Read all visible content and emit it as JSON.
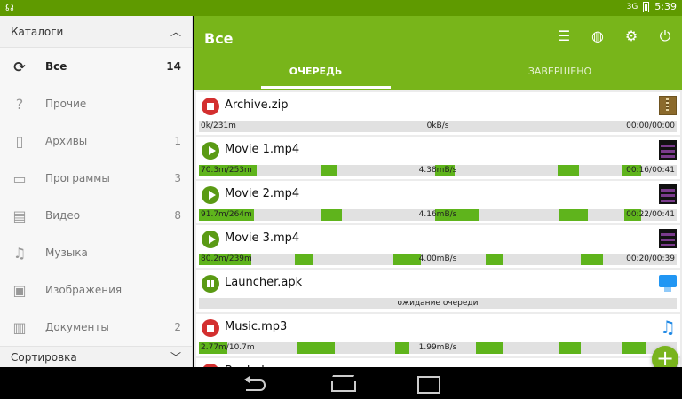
{
  "status_bar": {
    "left_icon": "☊",
    "signal": "3G",
    "time": "5:39"
  },
  "drawer": {
    "header": "Каталоги",
    "items": [
      {
        "icon": "refresh-icon",
        "glyph": "⟳",
        "label": "Все",
        "count": "14",
        "active": true
      },
      {
        "icon": "help-icon",
        "glyph": "?",
        "label": "Прочие",
        "count": ""
      },
      {
        "icon": "archive-icon",
        "glyph": "▯",
        "label": "Архивы",
        "count": "1"
      },
      {
        "icon": "monitor-icon",
        "glyph": "▭",
        "label": "Программы",
        "count": "3"
      },
      {
        "icon": "film-icon",
        "glyph": "▤",
        "label": "Видео",
        "count": "8"
      },
      {
        "icon": "music-icon",
        "glyph": "♫",
        "label": "Музыка",
        "count": ""
      },
      {
        "icon": "image-icon",
        "glyph": "▣",
        "label": "Изображения",
        "count": ""
      },
      {
        "icon": "document-icon",
        "glyph": "▥",
        "label": "Документы",
        "count": "2"
      }
    ],
    "sort_label": "Сортировка"
  },
  "appbar": {
    "title": "Все",
    "actions": [
      "list-icon",
      "globe-icon",
      "settings-icon",
      "power-icon"
    ],
    "tabs": [
      {
        "label": "ОЧЕРЕДЬ",
        "active": true
      },
      {
        "label": "ЗАВЕРШЕНО",
        "active": false
      }
    ]
  },
  "downloads": [
    {
      "name": "Archive.zip",
      "state": "stop",
      "type": "zip",
      "size": "0k/231m",
      "speed": "0kB/s",
      "time": "00:00/00:00",
      "segments": []
    },
    {
      "name": "Movie 1.mp4",
      "state": "play",
      "type": "video",
      "size": "70.3m/253m",
      "speed": "4.38mB/s",
      "time": "00:16/00:41",
      "segments": [
        [
          0.0,
          0.12
        ],
        [
          0.255,
          0.29
        ],
        [
          0.495,
          0.535
        ],
        [
          0.75,
          0.795
        ],
        [
          0.885,
          0.925
        ]
      ]
    },
    {
      "name": "Movie 2.mp4",
      "state": "play",
      "type": "video",
      "size": "91.7m/264m",
      "speed": "4.16mB/s",
      "time": "00:22/00:41",
      "segments": [
        [
          0.0,
          0.115
        ],
        [
          0.255,
          0.3
        ],
        [
          0.495,
          0.585
        ],
        [
          0.755,
          0.815
        ],
        [
          0.89,
          0.925
        ]
      ]
    },
    {
      "name": "Movie 3.mp4",
      "state": "play",
      "type": "video",
      "size": "80.2m/239m",
      "speed": "4.00mB/s",
      "time": "00:20/00:39",
      "segments": [
        [
          0.0,
          0.11
        ],
        [
          0.2,
          0.24
        ],
        [
          0.405,
          0.465
        ],
        [
          0.6,
          0.635
        ],
        [
          0.8,
          0.845
        ]
      ]
    },
    {
      "name": "Launcher.apk",
      "state": "pause",
      "type": "apk",
      "size": "",
      "speed": "ожидание очереди",
      "time": "",
      "segments": []
    },
    {
      "name": "Music.mp3",
      "state": "stop",
      "type": "music",
      "size": "2.77m/10.7m",
      "speed": "1.99mB/s",
      "time": "",
      "segments": [
        [
          0.0,
          0.06
        ],
        [
          0.205,
          0.285
        ],
        [
          0.41,
          0.44
        ],
        [
          0.58,
          0.635
        ],
        [
          0.755,
          0.8
        ],
        [
          0.885,
          0.935
        ]
      ]
    },
    {
      "name": "Book.doc",
      "state": "stop",
      "type": "doc",
      "size": "",
      "speed": "",
      "time": "",
      "segments": []
    }
  ],
  "fab": {
    "label": "+"
  },
  "colors": {
    "accent": "#78b51a",
    "statusbar": "#5f9a00",
    "progress": "#5fb41c",
    "stop": "#d32f2f"
  }
}
